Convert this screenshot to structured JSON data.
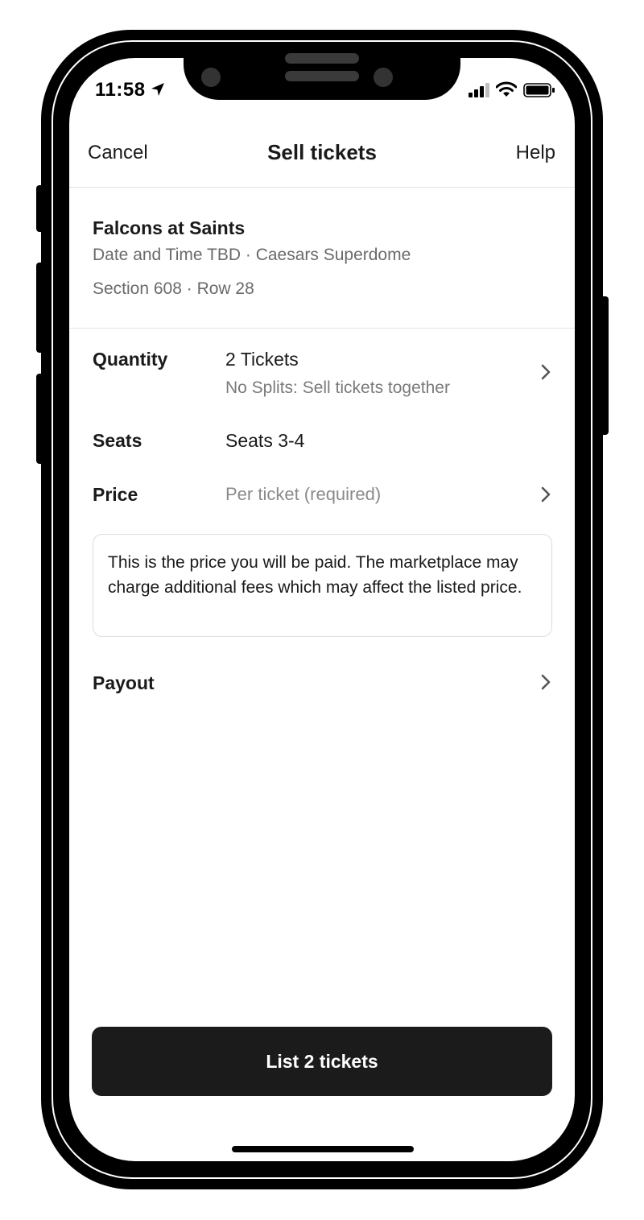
{
  "status_bar": {
    "time": "11:58",
    "icons": [
      "location-arrow-icon",
      "cellular-signal-icon",
      "wifi-icon",
      "battery-icon"
    ]
  },
  "nav": {
    "cancel_label": "Cancel",
    "title": "Sell tickets",
    "help_label": "Help"
  },
  "event": {
    "name": "Falcons at Saints",
    "date_venue": "Date and Time TBD · Caesars Superdome",
    "section_row": "Section 608 · Row 28"
  },
  "details": {
    "quantity": {
      "label": "Quantity",
      "value": "2 Tickets",
      "sub": "No Splits: Sell tickets together"
    },
    "seats": {
      "label": "Seats",
      "value": "Seats 3-4"
    },
    "price": {
      "label": "Price",
      "placeholder": "Per ticket (required)"
    },
    "price_notice": "This is the price you will be paid. The marketplace may charge additional fees which may affect the listed price.",
    "payout": {
      "label": "Payout"
    }
  },
  "cta": {
    "label": "List 2 tickets"
  },
  "colors": {
    "cta_background": "#1b1b1b",
    "secondary_text": "#6a6a6a",
    "divider": "#e3e3e3"
  }
}
